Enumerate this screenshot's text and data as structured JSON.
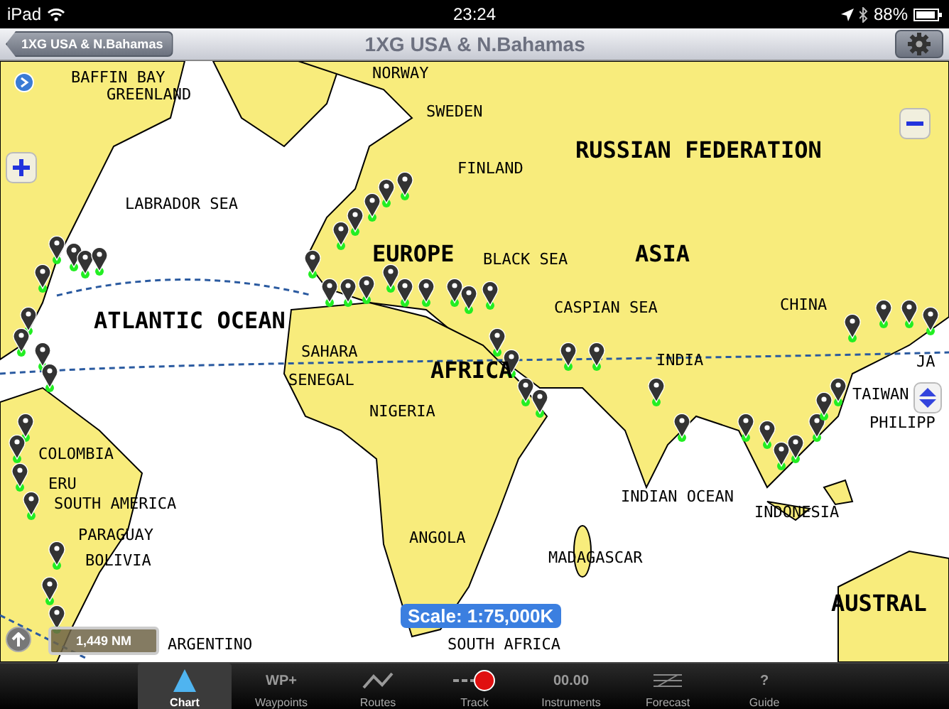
{
  "status_bar": {
    "device": "iPad",
    "time": "23:24",
    "battery": "88%"
  },
  "nav_bar": {
    "back_button": "1XG USA & N.Bahamas",
    "title": "1XG USA & N.Bahamas"
  },
  "map": {
    "labels": [
      {
        "text": "BAFFIN BAY",
        "kind": "minor"
      },
      {
        "text": "GREENLAND",
        "kind": "minor"
      },
      {
        "text": "NORWAY",
        "kind": "minor"
      },
      {
        "text": "SWEDEN",
        "kind": "minor"
      },
      {
        "text": "FINLAND",
        "kind": "minor"
      },
      {
        "text": "RUSSIAN FEDERATION",
        "kind": "major"
      },
      {
        "text": "LABRADOR SEA",
        "kind": "minor"
      },
      {
        "text": "EUROPE",
        "kind": "major"
      },
      {
        "text": "BLACK SEA",
        "kind": "minor"
      },
      {
        "text": "ASIA",
        "kind": "major"
      },
      {
        "text": "CASPIAN SEA",
        "kind": "minor"
      },
      {
        "text": "CHINA",
        "kind": "minor"
      },
      {
        "text": "JA",
        "kind": "minor"
      },
      {
        "text": "ATLANTIC OCEAN",
        "kind": "major"
      },
      {
        "text": "SAHARA",
        "kind": "minor"
      },
      {
        "text": "SENEGAL",
        "kind": "minor"
      },
      {
        "text": "AFRICA",
        "kind": "major"
      },
      {
        "text": "INDIA",
        "kind": "minor"
      },
      {
        "text": "TAIWAN",
        "kind": "minor"
      },
      {
        "text": "PHILIPP",
        "kind": "minor"
      },
      {
        "text": "NIGERIA",
        "kind": "minor"
      },
      {
        "text": "COLOMBIA",
        "kind": "minor"
      },
      {
        "text": "ERU",
        "kind": "minor"
      },
      {
        "text": "SOUTH AMERICA",
        "kind": "minor"
      },
      {
        "text": "PARAGUAY",
        "kind": "minor"
      },
      {
        "text": "BOLIVIA",
        "kind": "minor"
      },
      {
        "text": "ANGOLA",
        "kind": "minor"
      },
      {
        "text": "INDIAN OCEAN",
        "kind": "minor"
      },
      {
        "text": "INDONESIA",
        "kind": "minor"
      },
      {
        "text": "MADAGASCAR",
        "kind": "minor"
      },
      {
        "text": "AUSTRAL",
        "kind": "major"
      },
      {
        "text": "ARGENTINO",
        "kind": "minor"
      },
      {
        "text": "SOUTH AFRICA",
        "kind": "minor"
      }
    ],
    "scale": "Scale: 1:75,000K",
    "distance": "1,449 NM"
  },
  "tab_bar": [
    {
      "label": "Chart",
      "kind": "chart",
      "selected": true
    },
    {
      "label": "Waypoints",
      "kind": "waypoints",
      "icon_text": "WP+",
      "selected": false
    },
    {
      "label": "Routes",
      "kind": "routes",
      "selected": false
    },
    {
      "label": "Track",
      "kind": "track",
      "selected": false
    },
    {
      "label": "Instruments",
      "kind": "instruments",
      "icon_text": "00.00",
      "selected": false
    },
    {
      "label": "Forecast",
      "kind": "forecast",
      "selected": false
    },
    {
      "label": "Guide",
      "kind": "guide",
      "icon_text": "?",
      "selected": false
    }
  ]
}
